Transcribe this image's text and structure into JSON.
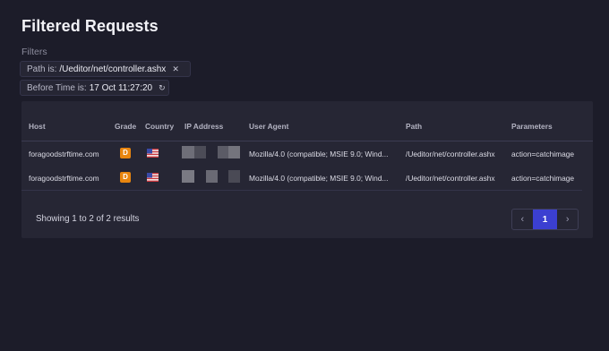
{
  "page": {
    "title": "Filtered Requests"
  },
  "filters": {
    "label": "Filters",
    "items": [
      {
        "key": "Path is:",
        "value": "/Ueditor/net/controller.ashx",
        "action_icon": "close-icon",
        "action_glyph": "✕"
      },
      {
        "key": "Before Time is:",
        "value": "17 Oct 11:27:20",
        "action_icon": "refresh-icon",
        "action_glyph": "↻"
      }
    ]
  },
  "table": {
    "columns": [
      "Host",
      "Grade",
      "Country",
      "IP Address",
      "User Agent",
      "Path",
      "Parameters"
    ],
    "rows": [
      {
        "host": "foragoodstrftime.com",
        "grade": "D",
        "grade_color": "#e8850f",
        "country_icon": "us-flag-icon",
        "user_agent": "Mozilla/4.0 (compatible; MSIE 9.0; Wind...",
        "path": "/Ueditor/net/controller.ashx",
        "parameters": "action=catchimage"
      },
      {
        "host": "foragoodstrftime.com",
        "grade": "D",
        "grade_color": "#e8850f",
        "country_icon": "us-flag-icon",
        "user_agent": "Mozilla/4.0 (compatible; MSIE 9.0; Wind...",
        "path": "/Ueditor/net/controller.ashx",
        "parameters": "action=catchimage"
      }
    ]
  },
  "footer": {
    "summary": "Showing 1 to 2 of 2 results"
  },
  "pagination": {
    "prev_glyph": "‹",
    "current_page": "1",
    "next_glyph": "›"
  },
  "colors": {
    "background": "#1c1c29",
    "card": "#262634",
    "accent": "#3b3fd1",
    "grade_d": "#e8850f"
  }
}
